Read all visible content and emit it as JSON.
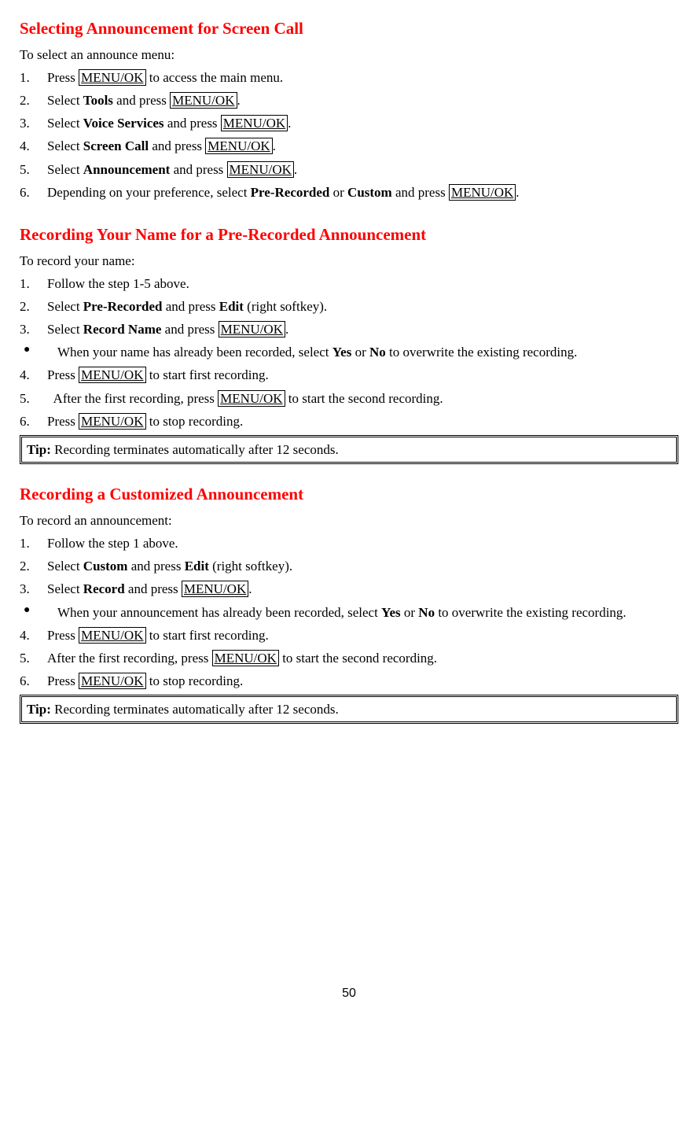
{
  "sections": [
    {
      "heading": "Selecting Announcement for Screen Call",
      "intro": "To select an announce menu:",
      "steps": [
        {
          "n": "1.",
          "pre": "Press ",
          "key": "MENU/OK",
          "post": " to access the main menu."
        },
        {
          "n": "2.",
          "pre": "Select ",
          "bold": "Tools",
          "mid": " and press ",
          "key": "MENU/OK",
          "post": "."
        },
        {
          "n": "3.",
          "pre": "Select ",
          "bold": "Voice Services",
          "mid": " and press ",
          "key": "MENU/OK",
          "post": "."
        },
        {
          "n": "4.",
          "pre": "Select ",
          "bold": "Screen Call",
          "mid": " and press ",
          "key": "MENU/OK",
          "post": "."
        },
        {
          "n": "5.",
          "pre": "Select ",
          "bold": "Announcement",
          "mid": " and press ",
          "key": "MENU/OK",
          "post": "."
        },
        {
          "n": "6.",
          "pre": "Depending on your preference, select ",
          "bold": "Pre-Recorded",
          "mid": " or ",
          "bold2": "Custom",
          "mid2": " and press ",
          "key": "MENU/OK",
          "post": "."
        }
      ]
    },
    {
      "heading": "Recording Your Name for a Pre-Recorded Announcement",
      "intro": "To record your name:",
      "steps2": [
        {
          "n": "1.",
          "text": "Follow the step 1-5 above."
        },
        {
          "n": "2.",
          "pre": "Select ",
          "bold": "Pre-Recorded",
          "mid": " and press ",
          "bold2": "Edit",
          "post": " (right softkey)."
        },
        {
          "n": "3.",
          "pre": "Select ",
          "bold": "Record Name",
          "mid": " and press ",
          "key": "MENU/OK",
          "post": "."
        }
      ],
      "bullet": {
        "pre": "When your name has already been recorded, select ",
        "bold": "Yes",
        "mid": " or ",
        "bold2": "No",
        "post": " to overwrite the existing recording."
      },
      "steps3": [
        {
          "n": "4.",
          "pre": "Press ",
          "key": "MENU/OK",
          "post": " to start first recording."
        },
        {
          "n": "5.",
          "pre": "  After the first recording, press ",
          "key": "MENU/OK",
          "post": " to start the second recording."
        },
        {
          "n": "6.",
          "pre": "Press ",
          "key": "MENU/OK",
          "post": " to stop recording."
        }
      ],
      "tip": {
        "label": "Tip:",
        "text": " Recording terminates automatically after 12 seconds."
      }
    },
    {
      "heading": "Recording a Customized Announcement",
      "intro": "To record an announcement:",
      "steps2": [
        {
          "n": "1.",
          "text": "Follow the step 1 above."
        },
        {
          "n": "2.",
          "pre": "Select ",
          "bold": "Custom",
          "mid": " and press ",
          "bold2": "Edit",
          "post": " (right softkey)."
        },
        {
          "n": "3.",
          "pre": "Select ",
          "bold": "Record",
          "mid": " and press ",
          "key": "MENU/OK",
          "post": "."
        }
      ],
      "bullet": {
        "pre": "When your announcement has already been recorded, select ",
        "bold": "Yes",
        "mid": " or ",
        "bold2": "No",
        "post": " to overwrite the existing recording."
      },
      "steps3": [
        {
          "n": "4.",
          "pre": "Press ",
          "key": "MENU/OK",
          "post": " to start first recording."
        },
        {
          "n": "5.",
          "pre": "After the first recording, press ",
          "key": "MENU/OK",
          "post": " to start the second recording."
        },
        {
          "n": "6.",
          "pre": "Press ",
          "key": "MENU/OK",
          "post": " to stop recording."
        }
      ],
      "tip": {
        "label": "Tip:",
        "text": " Recording terminates automatically after 12 seconds."
      }
    }
  ],
  "pagenum": "50"
}
